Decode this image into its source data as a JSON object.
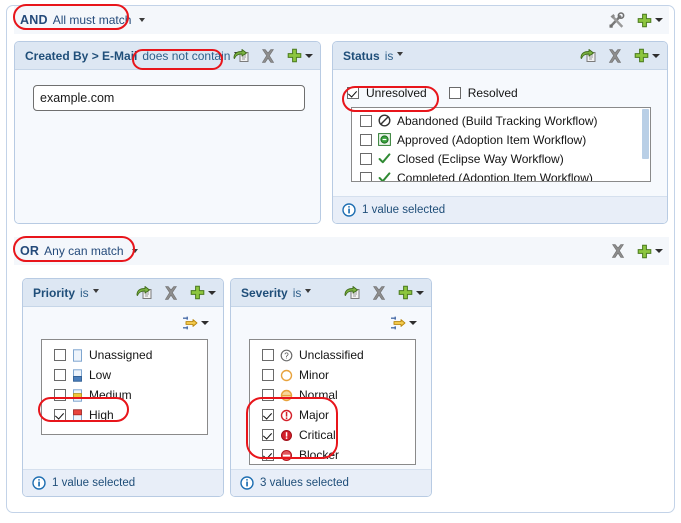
{
  "toolbar": {
    "tools_icon": "wrench-screwdriver-icon",
    "add_icon": "green-plus-icon",
    "dropdown_icon": "chevron-down-icon"
  },
  "groups": [
    {
      "operator": "AND",
      "description": "All must match",
      "conditions": [
        {
          "title": "Created By > E-Mail",
          "operator": "does not contain",
          "input_value": "example.com",
          "footer": ""
        },
        {
          "title": "Status",
          "operator": "is",
          "top_options": [
            {
              "label": "Unresolved",
              "checked": true
            },
            {
              "label": "Resolved",
              "checked": false
            }
          ],
          "list_items": [
            {
              "label": "Abandoned (Build Tracking Workflow)",
              "checked": false,
              "icon": "abandoned-icon"
            },
            {
              "label": "Approved (Adoption Item Workflow)",
              "checked": false,
              "icon": "approved-icon"
            },
            {
              "label": "Closed (Eclipse Way Workflow)",
              "checked": false,
              "icon": "closed-check-icon"
            },
            {
              "label": "Completed (Adoption Item Workflow)",
              "checked": false,
              "icon": "completed-check-icon"
            }
          ],
          "footer": "1 value selected"
        }
      ]
    },
    {
      "operator": "OR",
      "description": "Any can match",
      "conditions": [
        {
          "title": "Priority",
          "operator": "is",
          "list_items": [
            {
              "label": "Unassigned",
              "checked": false,
              "icon": "priority-unassigned-icon"
            },
            {
              "label": "Low",
              "checked": false,
              "icon": "priority-low-icon"
            },
            {
              "label": "Medium",
              "checked": false,
              "icon": "priority-medium-icon"
            },
            {
              "label": "High",
              "checked": true,
              "icon": "priority-high-icon"
            }
          ],
          "footer": "1 value selected"
        },
        {
          "title": "Severity",
          "operator": "is",
          "list_items": [
            {
              "label": "Unclassified",
              "checked": false,
              "icon": "severity-unclassified-icon"
            },
            {
              "label": "Minor",
              "checked": false,
              "icon": "severity-minor-icon"
            },
            {
              "label": "Normal",
              "checked": false,
              "icon": "severity-normal-icon"
            },
            {
              "label": "Major",
              "checked": true,
              "icon": "severity-major-icon"
            },
            {
              "label": "Critical",
              "checked": true,
              "icon": "severity-critical-icon"
            },
            {
              "label": "Blocker",
              "checked": true,
              "icon": "severity-blocker-icon"
            }
          ],
          "footer": "3 values selected"
        }
      ]
    }
  ],
  "icons": {
    "share": "share-reference-icon",
    "delete": "delete-x-icon",
    "add": "green-plus-icon",
    "dropdown": "chevron-down-icon",
    "sort": "move-arrow-icon",
    "info": "info-circle-icon"
  },
  "colors": {
    "accent": "#1f4e79",
    "highlight": "#e8151b",
    "panel_header": "#dde7f3",
    "panel_body": "#f6f9fd",
    "panel_footer": "#e8eef8",
    "add_green": "#7fbf3f",
    "priority_high": "#e8433c",
    "priority_medium": "#e8c33c",
    "priority_low": "#4a7ebb",
    "severity_red": "#d4202a",
    "severity_orange": "#e8a33d"
  }
}
